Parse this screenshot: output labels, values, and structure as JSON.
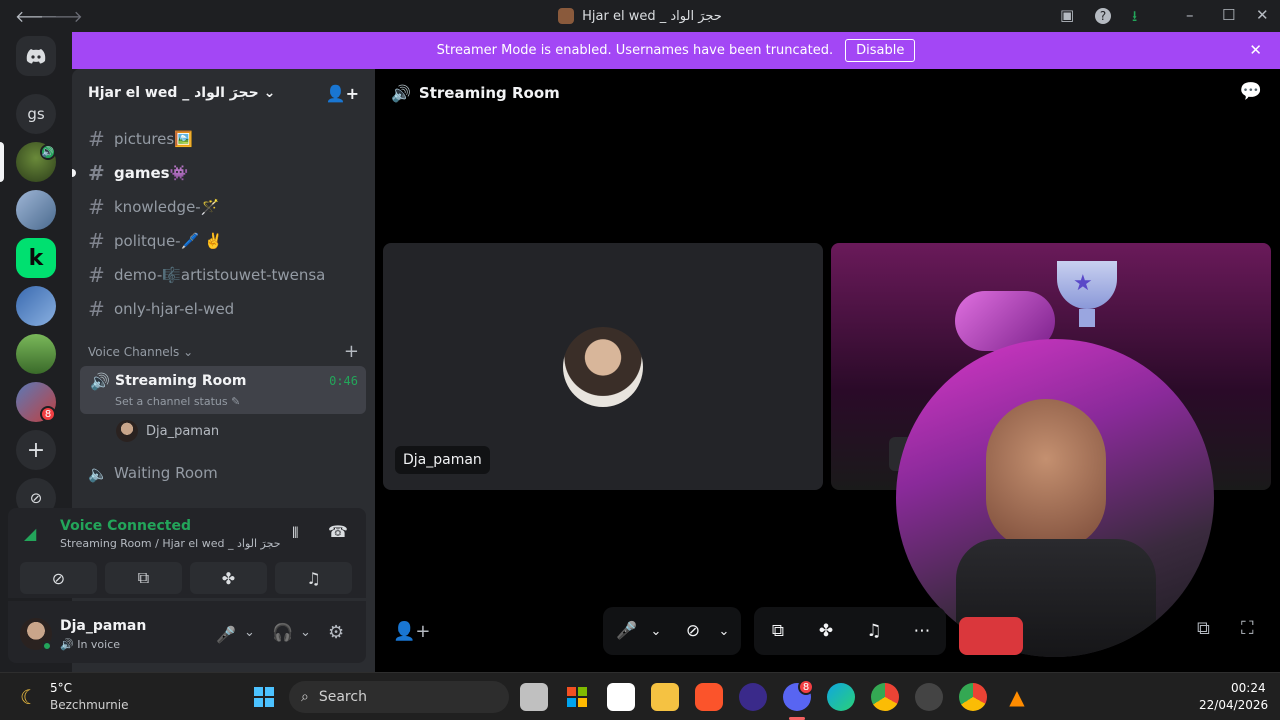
{
  "titlebar": {
    "title": "Hjar el wed _ حجرَ الواد"
  },
  "banner": {
    "text": "Streamer Mode is enabled. Usernames have been truncated.",
    "button": "Disable"
  },
  "rail": {
    "home_label": "gs",
    "badge_count": "8"
  },
  "sidebar": {
    "server_name": "Hjar el wed _ حجرَ الواد",
    "text_channels": [
      {
        "name": "pictures🖼️"
      },
      {
        "name": "games👾"
      },
      {
        "name": "knowledge-🪄"
      },
      {
        "name": "politque-🖊️ ✌️"
      },
      {
        "name": "demo-🎼artistouwet-twensa"
      },
      {
        "name": "only-hjar-el-wed"
      }
    ],
    "voice_category": "Voice Channels",
    "streaming_room": {
      "name": "Streaming Room",
      "time": "0:46",
      "status": "Set a channel status"
    },
    "room_user": "Dja_paman",
    "waiting_room": "Waiting Room"
  },
  "voice_panel": {
    "title": "Voice Connected",
    "subtitle": "Streaming Room / Hjar el wed _ حجرَ الواد"
  },
  "user_panel": {
    "name": "Dja_paman",
    "status": "In voice"
  },
  "main": {
    "channel_title": "Streaming Room",
    "tile_user": "Dja_paman"
  },
  "taskbar": {
    "weather_temp": "5°C",
    "weather_place": "Bezchmurnie",
    "search_placeholder": "Search",
    "discord_badge": "8",
    "time": "00:24",
    "date": "22/04/2026"
  },
  "colors": {
    "accent": "#a347f5",
    "voice_green": "#23a55a",
    "background": "#1e1f22",
    "sidebar": "#2b2d31"
  }
}
